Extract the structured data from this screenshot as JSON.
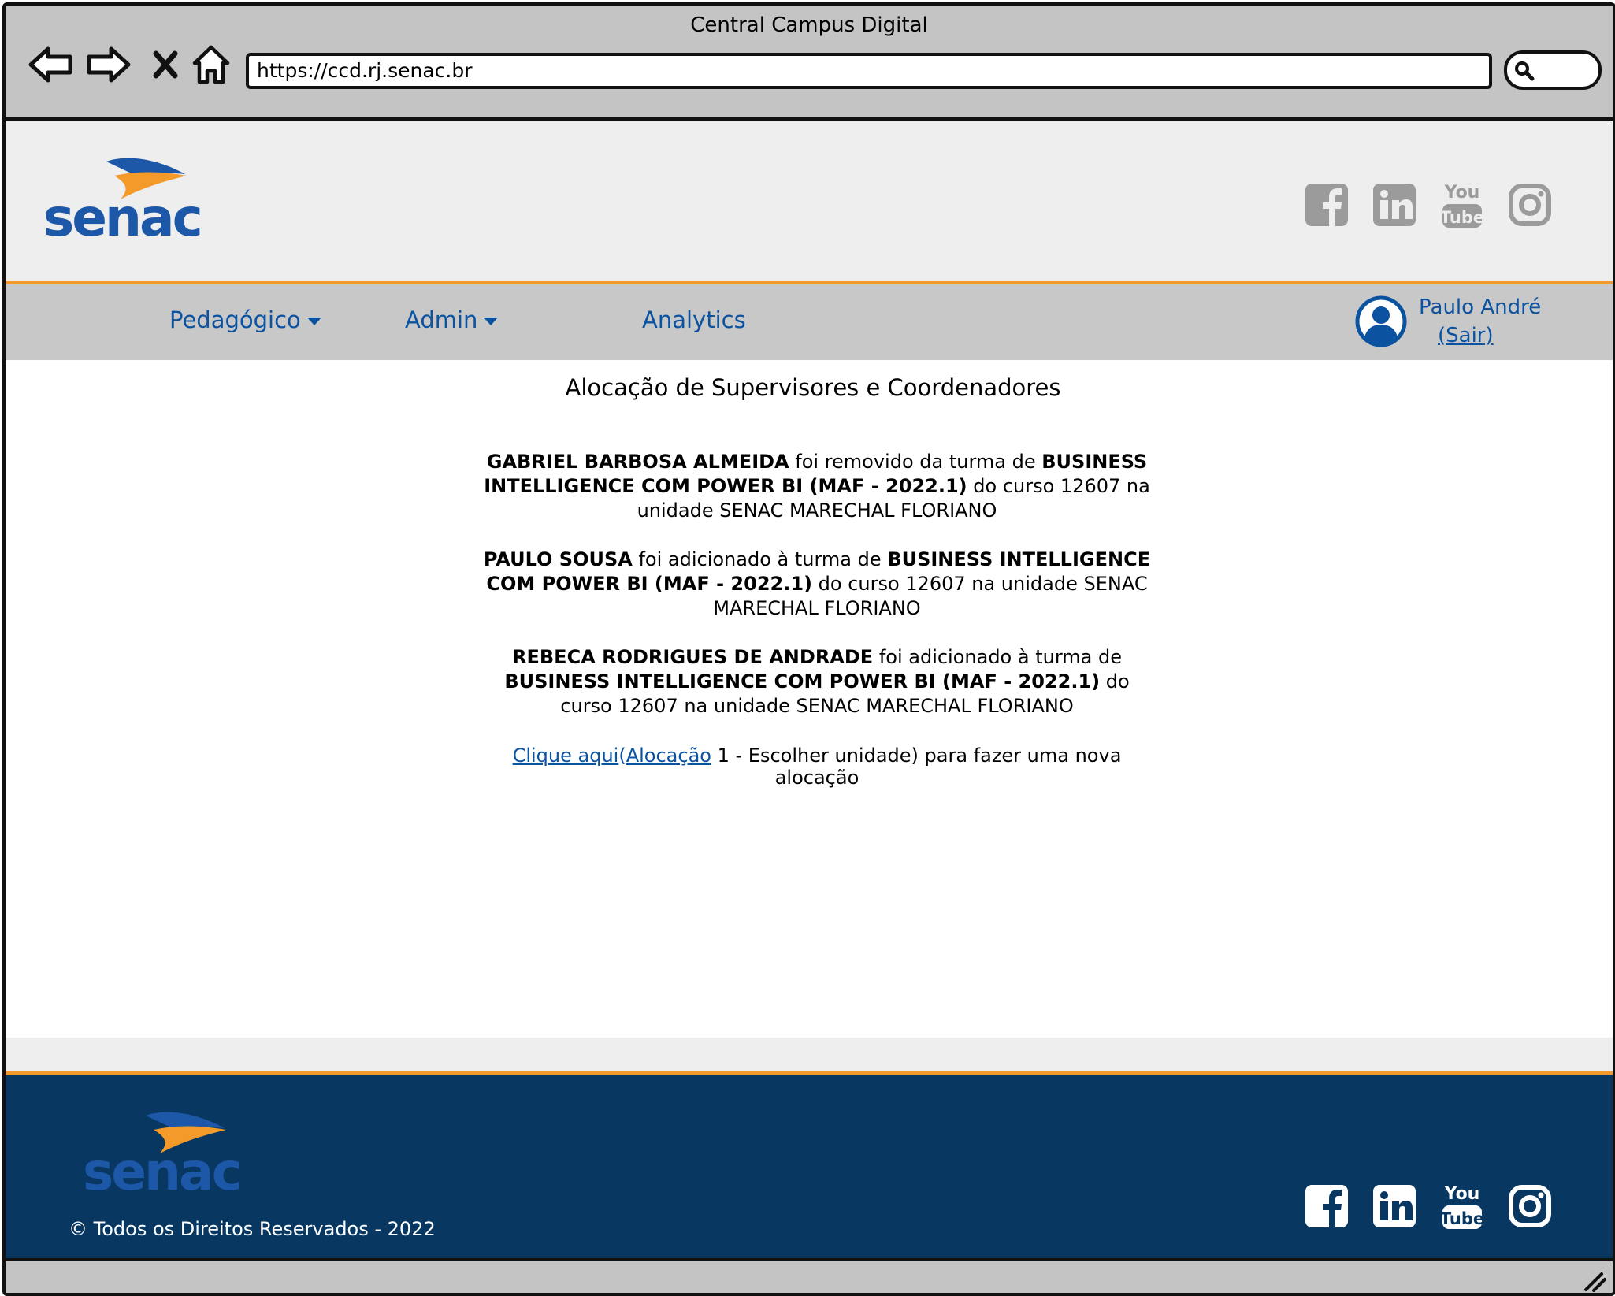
{
  "window": {
    "title": "Central Campus Digital"
  },
  "browser": {
    "url": "https://ccd.rj.senac.br",
    "buttons": [
      "back-arrow",
      "forward-arrow",
      "stop-x",
      "home-icon"
    ],
    "search_icon": "magnifier-icon"
  },
  "brand": {
    "logo_text": "senac",
    "colors": {
      "blue": "#0b52a0",
      "navy": "#083761",
      "orange": "#f39a2a"
    }
  },
  "social_icons": [
    "facebook-icon",
    "linkedin-icon",
    "youtube-icon",
    "instagram-icon"
  ],
  "social_youtube": {
    "top": "You",
    "bottom": "Tube"
  },
  "nav": {
    "items": [
      {
        "label": "Pedagógico",
        "dropdown": true
      },
      {
        "label": "Admin",
        "dropdown": true
      },
      {
        "label": "Analytics",
        "dropdown": false
      }
    ],
    "user": {
      "name": "Paulo André",
      "logout": "(Sair)"
    }
  },
  "main": {
    "title": "Alocação de Supervisores e Coordenadores",
    "messages": [
      {
        "person": "GABRIEL BARBOSA ALMEIDA",
        "action": " foi removido da turma de ",
        "class_name": "BUSINESS INTELLIGENCE COM POWER BI (MAF - 2022.1)",
        "rest": " do curso 12607 na unidade SENAC MARECHAL FLORIANO"
      },
      {
        "person": "PAULO SOUSA",
        "action": " foi adicionado à turma de ",
        "class_name": "BUSINESS INTELLIGENCE COM POWER BI (MAF - 2022.1)",
        "rest": " do curso 12607 na unidade SENAC MARECHAL FLORIANO"
      },
      {
        "person": "REBECA RODRIGUES DE ANDRADE",
        "action": " foi adicionado à turma de ",
        "class_name": "BUSINESS INTELLIGENCE COM POWER BI (MAF - 2022.1)",
        "rest": " do curso 12607 na unidade SENAC MARECHAL FLORIANO"
      }
    ],
    "new_link": {
      "link_text": "Clique aqui",
      "paren_open": "(",
      "ref_text": "Alocação",
      "after": " 1 - Escolher unidade) para fazer uma nova alocação"
    }
  },
  "footer": {
    "copyright": "© Todos os Direitos Reservados - 2022"
  }
}
